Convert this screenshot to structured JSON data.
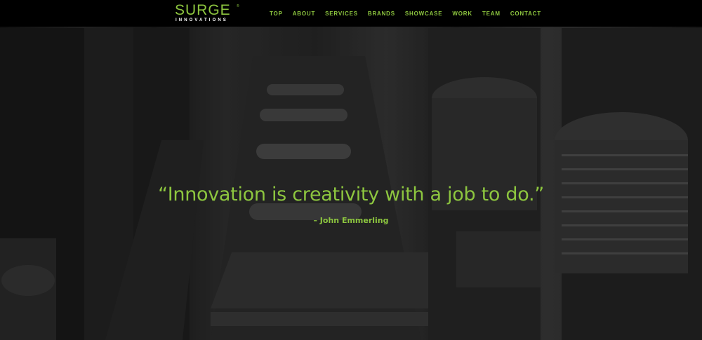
{
  "header": {
    "logo_main": "SURGE",
    "logo_sub": "INNOVATIONS",
    "logo_tm": "®",
    "nav": [
      {
        "label": "TOP"
      },
      {
        "label": "ABOUT"
      },
      {
        "label": "SERVICES"
      },
      {
        "label": "BRANDS"
      },
      {
        "label": "SHOWCASE"
      },
      {
        "label": "WORK"
      },
      {
        "label": "TEAM"
      },
      {
        "label": "CONTACT"
      }
    ]
  },
  "hero": {
    "quote": "“Innovation is creativity with a job to do.”",
    "author": "– John Emmerling"
  },
  "colors": {
    "accent": "#8dc63f",
    "header_bg": "#000000"
  }
}
